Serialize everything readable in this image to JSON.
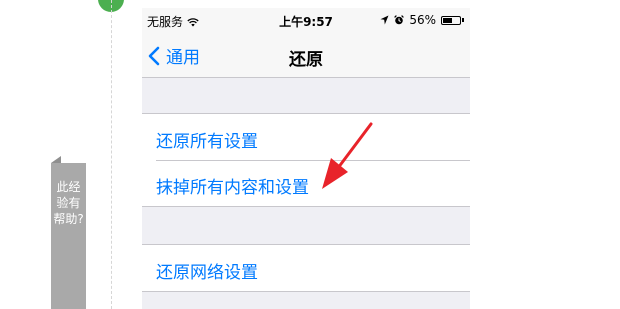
{
  "status_bar": {
    "carrier": "无服务",
    "wifi_icon": "wifi-icon",
    "time": "上午9:57",
    "location_icon": "location-arrow-icon",
    "alarm_icon": "alarm-clock-icon",
    "battery_percent": "56%",
    "battery_level": 0.56
  },
  "nav": {
    "back_label": "通用",
    "title": "还原"
  },
  "group1": {
    "items": [
      "还原所有设置",
      "抹掉所有内容和设置"
    ]
  },
  "group2": {
    "items": [
      "还原网络设置"
    ]
  },
  "side_tab": {
    "label": "此经验有帮助?"
  },
  "annotation": {
    "arrow_color": "#e8232a"
  }
}
